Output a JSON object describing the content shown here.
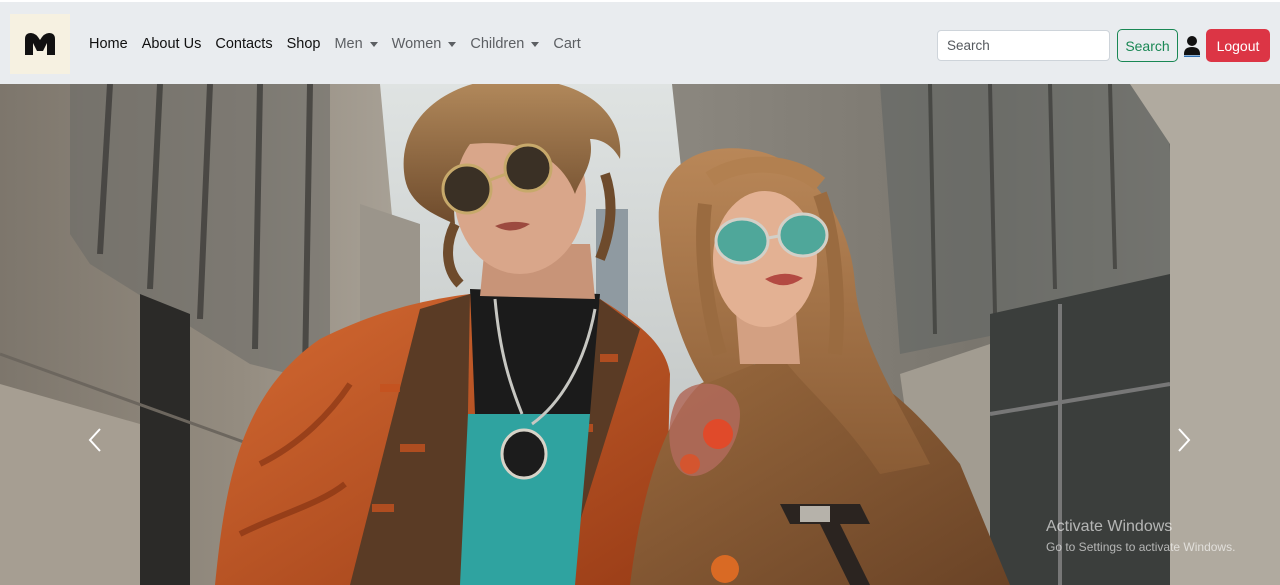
{
  "nav": {
    "brand": "M",
    "links": [
      {
        "label": "Home"
      },
      {
        "label": "About Us"
      },
      {
        "label": "Contacts"
      },
      {
        "label": "Shop"
      },
      {
        "label": "Men"
      },
      {
        "label": "Women"
      },
      {
        "label": "Children"
      },
      {
        "label": "Cart"
      }
    ],
    "search_placeholder": "Search",
    "search_label": "Search",
    "logout_label": "Logout"
  },
  "hero": {
    "image": "fashion-couple-photo"
  },
  "watermark": {
    "title": "Activate Windows",
    "subtitle": "Go to Settings to activate Windows."
  },
  "colors": {
    "navbar_bg": "#e9ecef",
    "search_green": "#198754",
    "logout_red": "#dc3545"
  }
}
